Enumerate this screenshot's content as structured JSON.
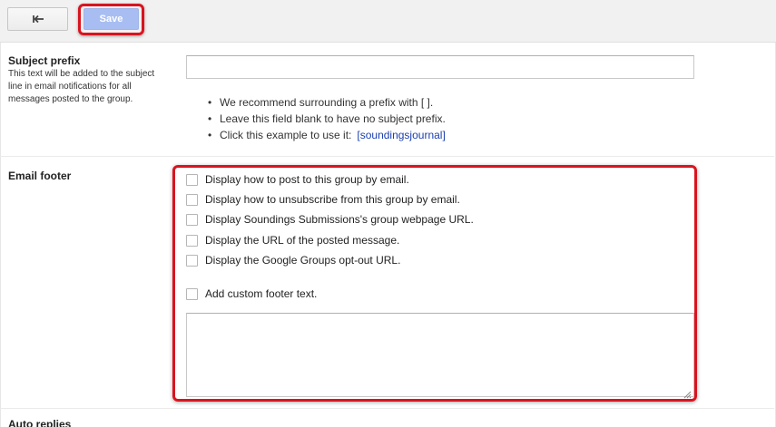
{
  "toolbar": {
    "back_icon": "back-arrow-icon",
    "save_label": "Save"
  },
  "subject_prefix": {
    "title": "Subject prefix",
    "description": "This text will be added to the subject line in email notifications for all messages posted to the group.",
    "input_value": "",
    "hints": [
      "We recommend surrounding a prefix with [ ].",
      "Leave this field blank to have no subject prefix.",
      "Click this example to use it:"
    ],
    "example_link": "[soundingsjournal]"
  },
  "email_footer": {
    "title": "Email footer",
    "options": [
      {
        "label": "Display how to post to this group by email.",
        "checked": false
      },
      {
        "label": "Display how to unsubscribe from this group by email.",
        "checked": false
      },
      {
        "label": "Display Soundings Submissions's group webpage URL.",
        "checked": false
      },
      {
        "label": "Display the URL of the posted message.",
        "checked": false
      },
      {
        "label": "Display the Google Groups opt-out URL.",
        "checked": false
      }
    ],
    "custom_option": {
      "label": "Add custom footer text.",
      "checked": false
    },
    "custom_text": ""
  },
  "auto_replies": {
    "title": "Auto replies"
  },
  "colors": {
    "highlight": "#d9141f",
    "save_button": "#a8bef2",
    "link": "#1a3fb0"
  }
}
